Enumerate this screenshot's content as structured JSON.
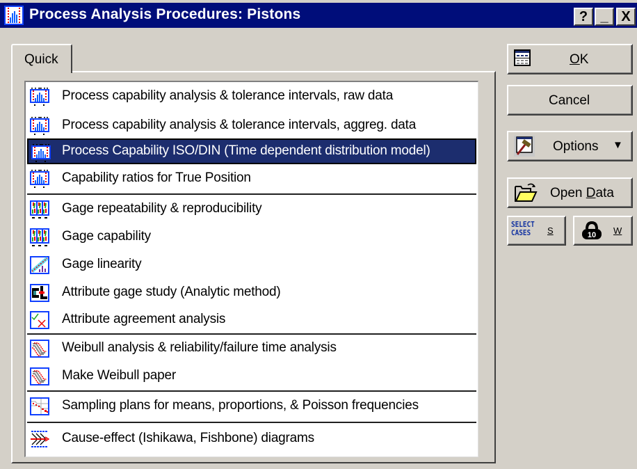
{
  "window": {
    "title": "Process Analysis Procedures: Pistons",
    "icon": "histogram-app-icon",
    "controls": {
      "help": "?",
      "minimize": "_",
      "close": "X"
    }
  },
  "tabs": [
    {
      "label": "Quick",
      "active": true
    }
  ],
  "list": {
    "selected_index": 2,
    "groups": [
      {
        "items": [
          {
            "label": "Process capability analysis & tolerance intervals, raw data",
            "icon": "process-capability-icon"
          },
          {
            "label": "Process capability analysis & tolerance intervals, aggreg. data",
            "icon": "process-capability-icon"
          },
          {
            "label": "Process Capability  ISO/DIN (Time dependent distribution model)",
            "icon": "process-capability-icon"
          },
          {
            "label": "Capability ratios for True Position",
            "icon": "process-capability-icon"
          }
        ]
      },
      {
        "items": [
          {
            "label": "Gage repeatability & reproducibility",
            "icon": "gage-rr-icon"
          },
          {
            "label": "Gage capability",
            "icon": "gage-rr-icon"
          },
          {
            "label": "Gage linearity",
            "icon": "gage-linearity-icon"
          },
          {
            "label": "Attribute gage study (Analytic method)",
            "icon": "attribute-gage-icon"
          },
          {
            "label": "Attribute agreement analysis",
            "icon": "attribute-agreement-icon"
          }
        ]
      },
      {
        "items": [
          {
            "label": "Weibull analysis & reliability/failure time analysis",
            "icon": "weibull-icon"
          },
          {
            "label": "Make Weibull paper",
            "icon": "weibull-icon"
          }
        ]
      },
      {
        "items": [
          {
            "label": "Sampling plans for means, proportions, & Poisson frequencies",
            "icon": "sampling-plans-icon"
          }
        ]
      },
      {
        "items": [
          {
            "label": "Cause-effect (Ishikawa, Fishbone) diagrams",
            "icon": "fishbone-icon"
          }
        ]
      }
    ]
  },
  "buttons": {
    "ok": {
      "label": "OK",
      "mnemonic": "O",
      "rest": "K",
      "icon": "spreadsheet-icon"
    },
    "cancel": {
      "label": "Cancel"
    },
    "options": {
      "label": "Options",
      "icon": "hammer-icon",
      "dropdown": "▼"
    },
    "open_data": {
      "label": "Open Data",
      "pre": "Open ",
      "mnemonic": "D",
      "rest": "ata",
      "icon": "open-folder-icon"
    },
    "select_cases": {
      "icon_text_1": "SELECT",
      "icon_text_2": "CASES",
      "mnemonic": "S"
    },
    "weights": {
      "icon_text": "10",
      "mnemonic": "W"
    }
  }
}
